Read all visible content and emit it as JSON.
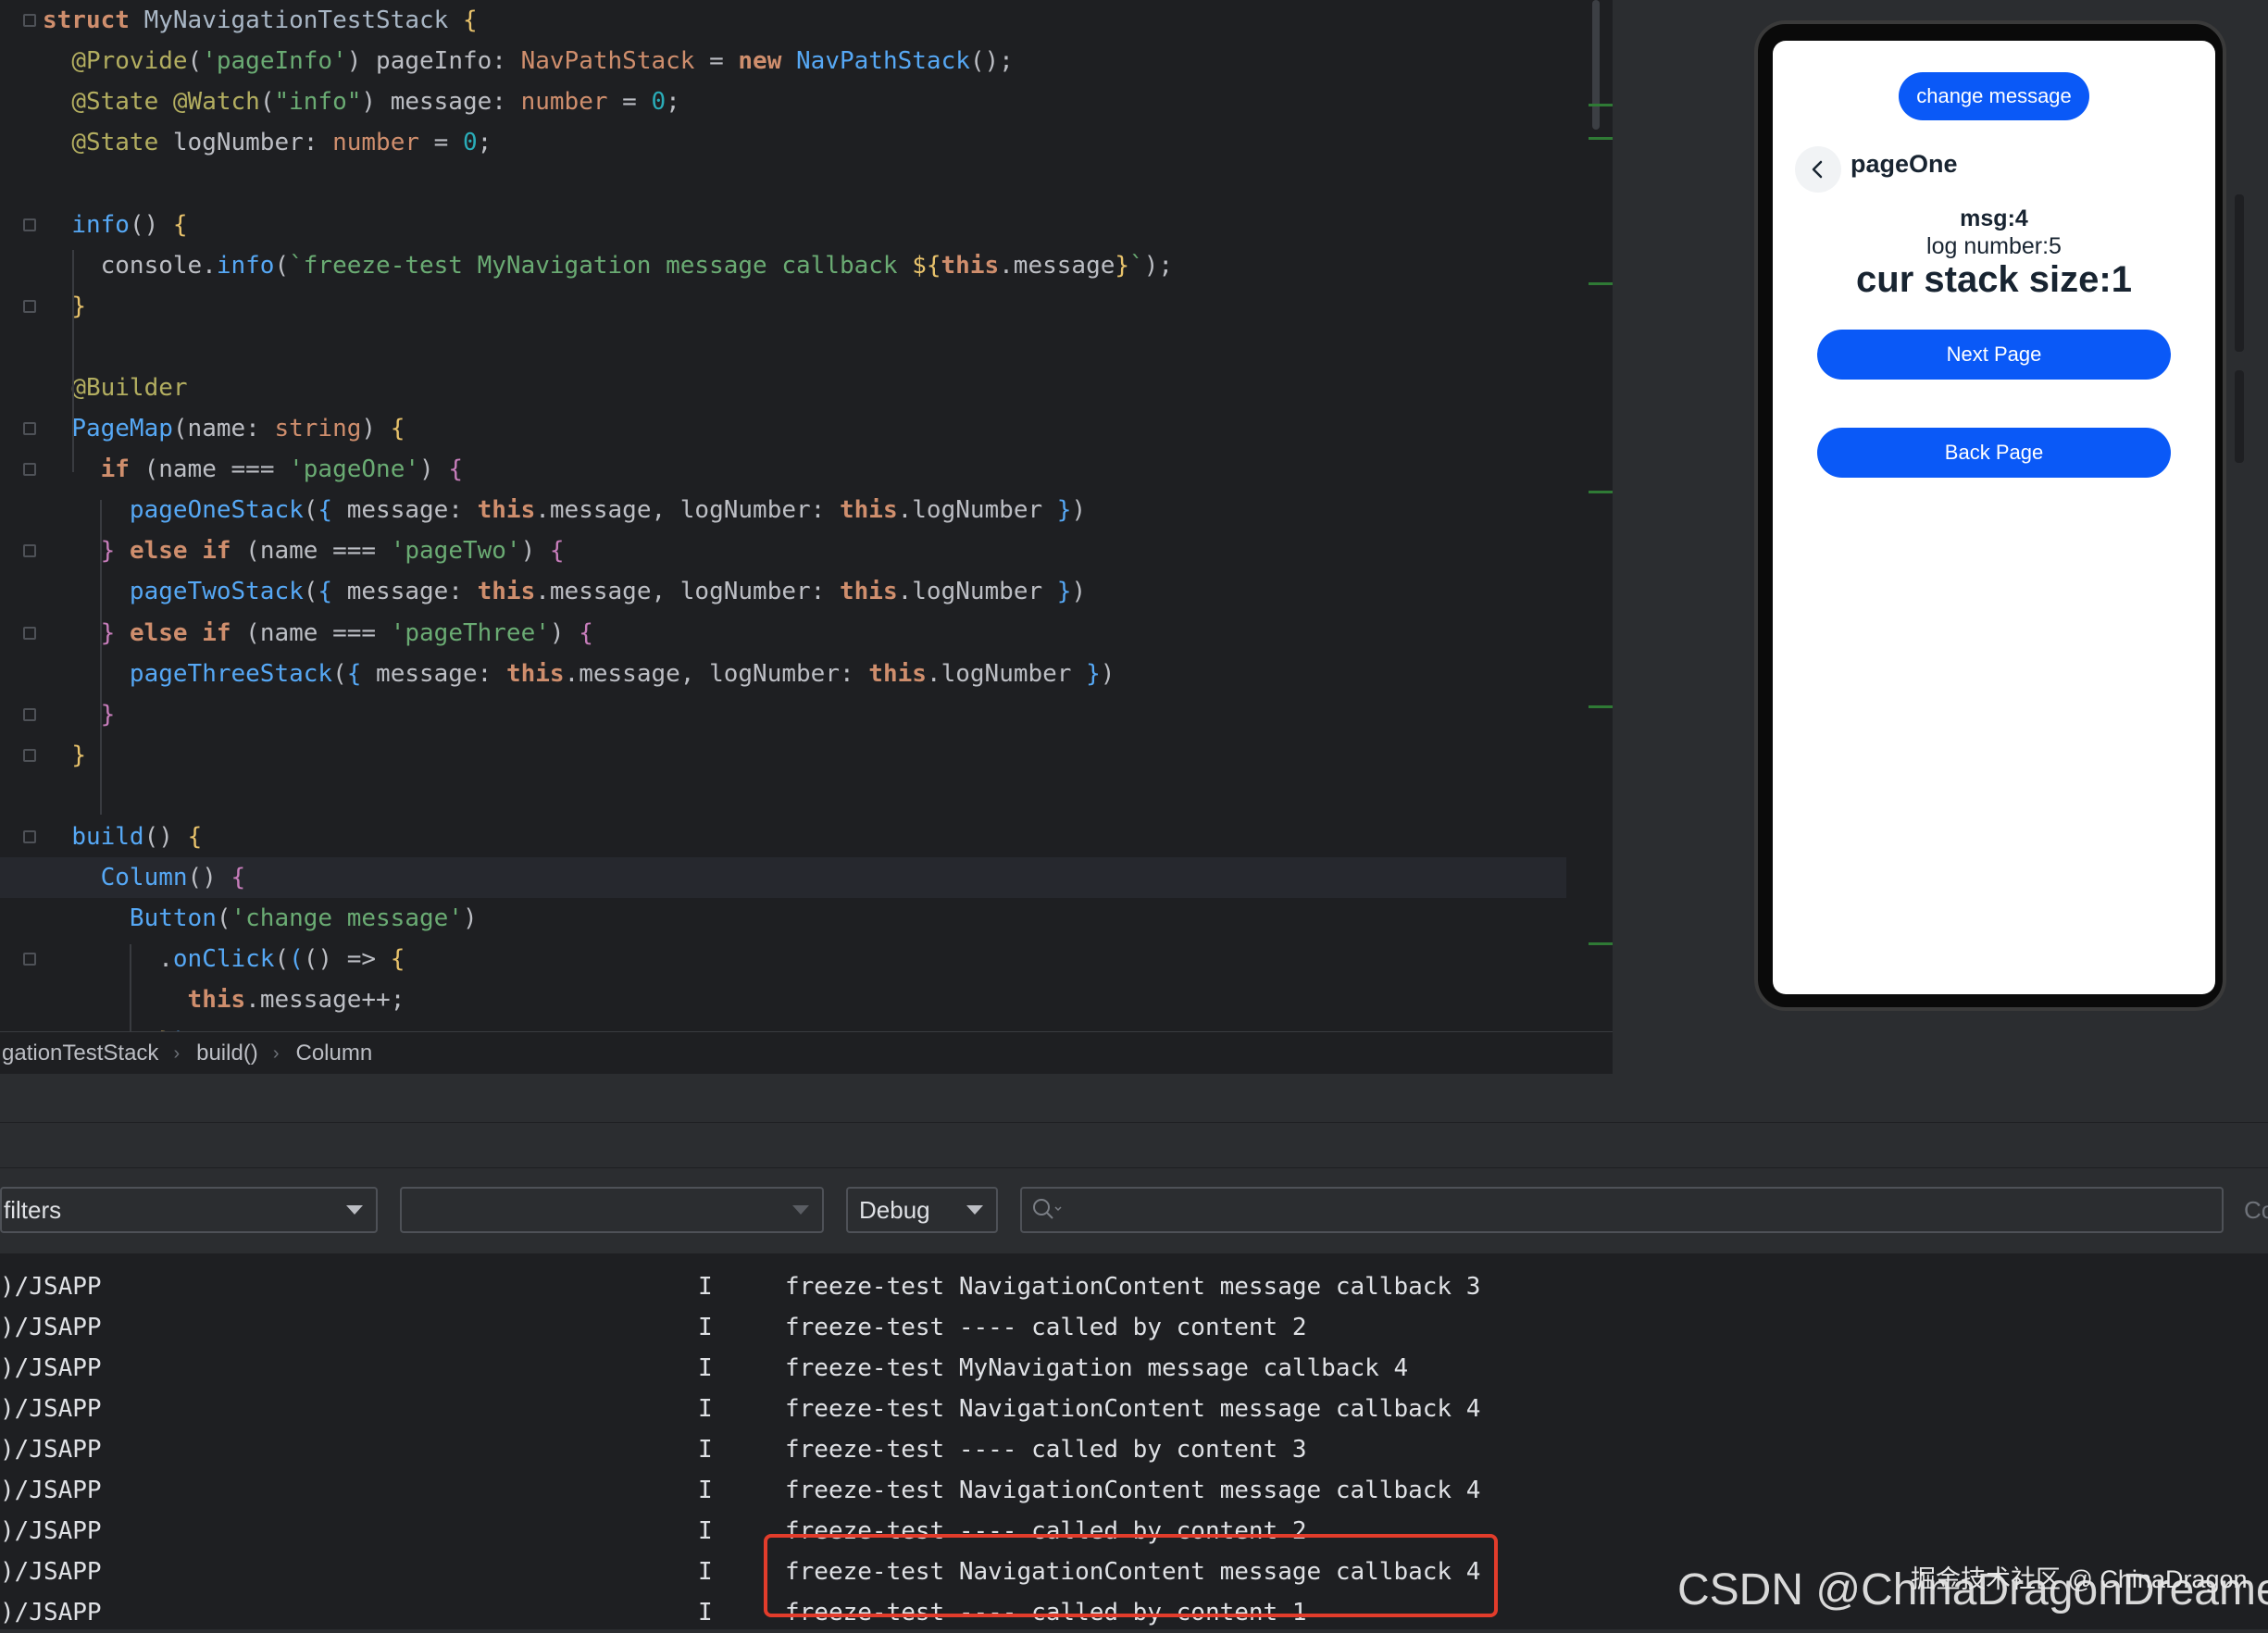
{
  "editor": {
    "lines": [
      {
        "html": "<span class='kw'>struct</span> <span class='cls'>MyNavigationTestStack</span> <span class='brc'>{</span>"
      },
      {
        "html": "  <span class='dec'>@Provide</span>(<span class='str'>'pageInfo'</span>) pageInfo: <span class='kwp'>NavPathStack</span> = <span class='kw'>new</span> <span class='ty'>NavPathStack</span>();"
      },
      {
        "html": "  <span class='dec'>@State</span> <span class='dec'>@Watch</span>(<span class='str'>\"info\"</span>) message: <span class='kwp'>number</span> = <span class='num'>0</span>;"
      },
      {
        "html": "  <span class='dec'>@State</span> logNumber: <span class='kwp'>number</span> = <span class='num'>0</span>;"
      },
      {
        "html": ""
      },
      {
        "html": "  <span class='fn'>info</span>() <span class='brc'>{</span>"
      },
      {
        "html": "    console.<span class='fn'>info</span>(<span class='str'>`freeze-test MyNavigation message callback </span><span class='brc'>${</span><span class='kw'>this</span>.message<span class='brc'>}</span><span class='str'>`</span>);"
      },
      {
        "html": "  <span class='brc'>}</span>"
      },
      {
        "html": ""
      },
      {
        "html": "  <span class='dec'>@Builder</span>"
      },
      {
        "html": "  <span class='fn'>PageMap</span>(name: <span class='kwp'>string</span>) <span class='brc'>{</span>"
      },
      {
        "html": "    <span class='kw'>if</span> (name === <span class='str'>'pageOne'</span>) <span class='ph'>{</span>"
      },
      {
        "html": "      <span class='fn'>pageOneStack</span>(<span class='ty'>{</span> message: <span class='kw'>this</span>.message, logNumber: <span class='kw'>this</span>.logNumber <span class='ty'>}</span>)"
      },
      {
        "html": "    <span class='ph'>}</span> <span class='kw'>else if</span> (name === <span class='str'>'pageTwo'</span>) <span class='ph'>{</span>"
      },
      {
        "html": "      <span class='fn'>pageTwoStack</span>(<span class='ty'>{</span> message: <span class='kw'>this</span>.message, logNumber: <span class='kw'>this</span>.logNumber <span class='ty'>}</span>)"
      },
      {
        "html": "    <span class='ph'>}</span> <span class='kw'>else if</span> (name === <span class='str'>'pageThree'</span>) <span class='ph'>{</span>"
      },
      {
        "html": "      <span class='fn'>pageThreeStack</span>(<span class='ty'>{</span> message: <span class='kw'>this</span>.message, logNumber: <span class='kw'>this</span>.logNumber <span class='ty'>}</span>)"
      },
      {
        "html": "    <span class='ph'>}</span>"
      },
      {
        "html": "  <span class='brc'>}</span>"
      },
      {
        "html": ""
      },
      {
        "html": "  <span class='fn'>build</span>() <span class='brc'>{</span>"
      },
      {
        "html": "    <span class='fn'>Column</span>() <span class='ph'>{</span>"
      },
      {
        "html": "      <span class='fn'>Button</span>(<span class='str'>'change message'</span>)"
      },
      {
        "html": "        .<span class='fn'>onClick</span>(<span class='ty'>(</span>() => <span class='brc'>{</span>"
      },
      {
        "html": "          <span class='kw'>this</span>.message++;"
      },
      {
        "html": "        <span class='brc'>}</span><span class='ty'>)</span>"
      }
    ],
    "active_line": 21
  },
  "breadcrumbs": [
    "gationTestStack",
    "build()",
    "Column"
  ],
  "preview": {
    "change_message_label": "change message",
    "page_title": "pageOne",
    "msg_text": "msg:4",
    "log_number_text": "log number:5",
    "stack_size_text": "cur stack size:1",
    "next_page_label": "Next Page",
    "back_page_label": "Back Page"
  },
  "filters": {
    "filter_select": "filters",
    "process_select": "",
    "level_select": "Debug",
    "search_placeholder": ""
  },
  "log": {
    "rows": [
      {
        "tag": ")/JSAPP",
        "level": "I",
        "message": "freeze-test NavigationContent message callback 3"
      },
      {
        "tag": ")/JSAPP",
        "level": "I",
        "message": "freeze-test ---- called by content 2"
      },
      {
        "tag": ")/JSAPP",
        "level": "I",
        "message": "freeze-test MyNavigation message callback 4"
      },
      {
        "tag": ")/JSAPP",
        "level": "I",
        "message": "freeze-test NavigationContent message callback 4"
      },
      {
        "tag": ")/JSAPP",
        "level": "I",
        "message": "freeze-test ---- called by content 3"
      },
      {
        "tag": ")/JSAPP",
        "level": "I",
        "message": "freeze-test NavigationContent message callback 4"
      },
      {
        "tag": ")/JSAPP",
        "level": "I",
        "message": "freeze-test ---- called by content 2"
      },
      {
        "tag": ")/JSAPP",
        "level": "I",
        "message": "freeze-test NavigationContent message callback 4"
      },
      {
        "tag": ")/JSAPP",
        "level": "I",
        "message": "freeze-test ---- called by content 1"
      }
    ]
  },
  "watermark": "CSDN @ChinaDragonDreamer",
  "watermark_overlay": "掘金技术社区 @ ChinaDragon",
  "colors": {
    "button_blue": "#0a59f7",
    "highlight_red": "#e23c2b",
    "editor_bg": "#1e1f22"
  }
}
